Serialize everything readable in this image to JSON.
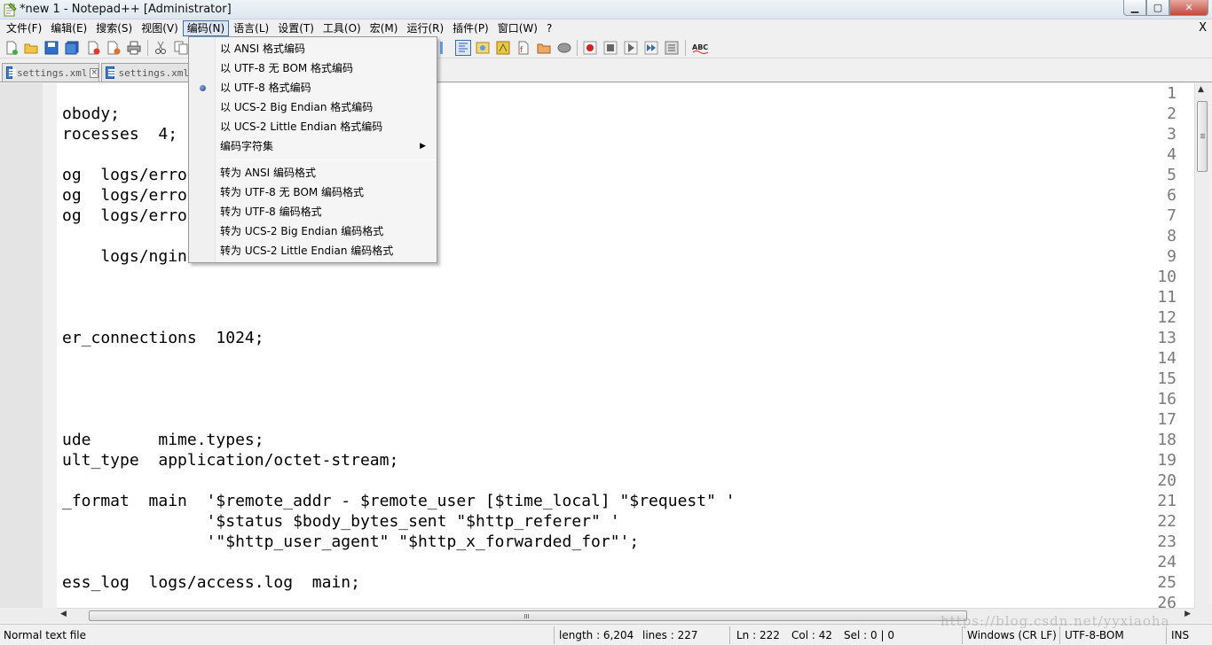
{
  "window": {
    "title": "*new 1 - Notepad++ [Administrator]",
    "app_icon": "notepad-plus-icon",
    "controls": {
      "minimize": "▁",
      "maximize": "▢",
      "close": "✕"
    }
  },
  "menubar": {
    "items": [
      {
        "label": "文件(F)"
      },
      {
        "label": "编辑(E)"
      },
      {
        "label": "搜索(S)"
      },
      {
        "label": "视图(V)"
      },
      {
        "label": "编码(N)"
      },
      {
        "label": "语言(L)"
      },
      {
        "label": "设置(T)"
      },
      {
        "label": "工具(O)"
      },
      {
        "label": "宏(M)"
      },
      {
        "label": "运行(R)"
      },
      {
        "label": "插件(P)"
      },
      {
        "label": "窗口(W)"
      },
      {
        "label": "?"
      }
    ],
    "active_index": 4,
    "close_label": "X"
  },
  "tabs": [
    {
      "label": "settings.xml",
      "icon": "file-icon",
      "close": "×"
    },
    {
      "label": "settings.xml",
      "icon": "file-icon",
      "close": "×"
    }
  ],
  "editor": {
    "line_numbers": [
      "1",
      "2",
      "3",
      "4",
      "5",
      "6",
      "7",
      "8",
      "9",
      "10",
      "11",
      "12",
      "13",
      "14",
      "15",
      "16",
      "17",
      "18",
      "19",
      "20",
      "21",
      "22",
      "23",
      "24",
      "25",
      "26"
    ],
    "lines": [
      "",
      "obody;",
      "rocesses  4;",
      "",
      "og  logs/erro",
      "og  logs/erro",
      "og  logs/erro",
      "",
      "    logs/ngin",
      "",
      "",
      "",
      "er_connections  1024;",
      "",
      "",
      "",
      "",
      "ude       mime.types;",
      "ult_type  application/octet-stream;",
      "",
      "_format  main  '$remote_addr - $remote_user [$time_local] \"$request\" '",
      "               '$status $body_bytes_sent \"$http_referer\" '",
      "               '\"$http_user_agent\" \"$http_x_forwarded_for\"';",
      "",
      "ess_log  logs/access.log  main;",
      ""
    ]
  },
  "encoding_menu": {
    "items": [
      {
        "label": "以 ANSI 格式编码",
        "checked": false
      },
      {
        "label": "以 UTF-8 无 BOM 格式编码",
        "checked": false
      },
      {
        "label": "以 UTF-8 格式编码",
        "checked": true
      },
      {
        "label": "以 UCS-2 Big Endian 格式编码",
        "checked": false
      },
      {
        "label": "以 UCS-2 Little Endian 格式编码",
        "checked": false
      },
      {
        "label": "编码字符集",
        "checked": false,
        "submenu": true
      }
    ],
    "convert_items": [
      {
        "label": "转为 ANSI 编码格式"
      },
      {
        "label": "转为 UTF-8 无 BOM 编码格式"
      },
      {
        "label": "转为 UTF-8 编码格式"
      },
      {
        "label": "转为 UCS-2 Big Endian 编码格式"
      },
      {
        "label": "转为 UCS-2 Little Endian 编码格式"
      }
    ],
    "submenu_arrow": "▶"
  },
  "statusbar": {
    "file_type": "Normal text file",
    "length": "length : 6,204",
    "lines": "lines : 227",
    "ln": "Ln : 222",
    "col": "Col : 42",
    "sel": "Sel : 0 | 0",
    "eol": "Windows (CR LF)",
    "encoding": "UTF-8-BOM",
    "mode": "INS"
  },
  "watermark": "https://blog.csdn.net/yyxiaoha",
  "colors": {
    "gutter_bg": "#e4e4e4",
    "line_number": "#7a7a7a",
    "menu_active_border": "#3b6ea5",
    "menu_active_bg": "#dbe7f5"
  }
}
